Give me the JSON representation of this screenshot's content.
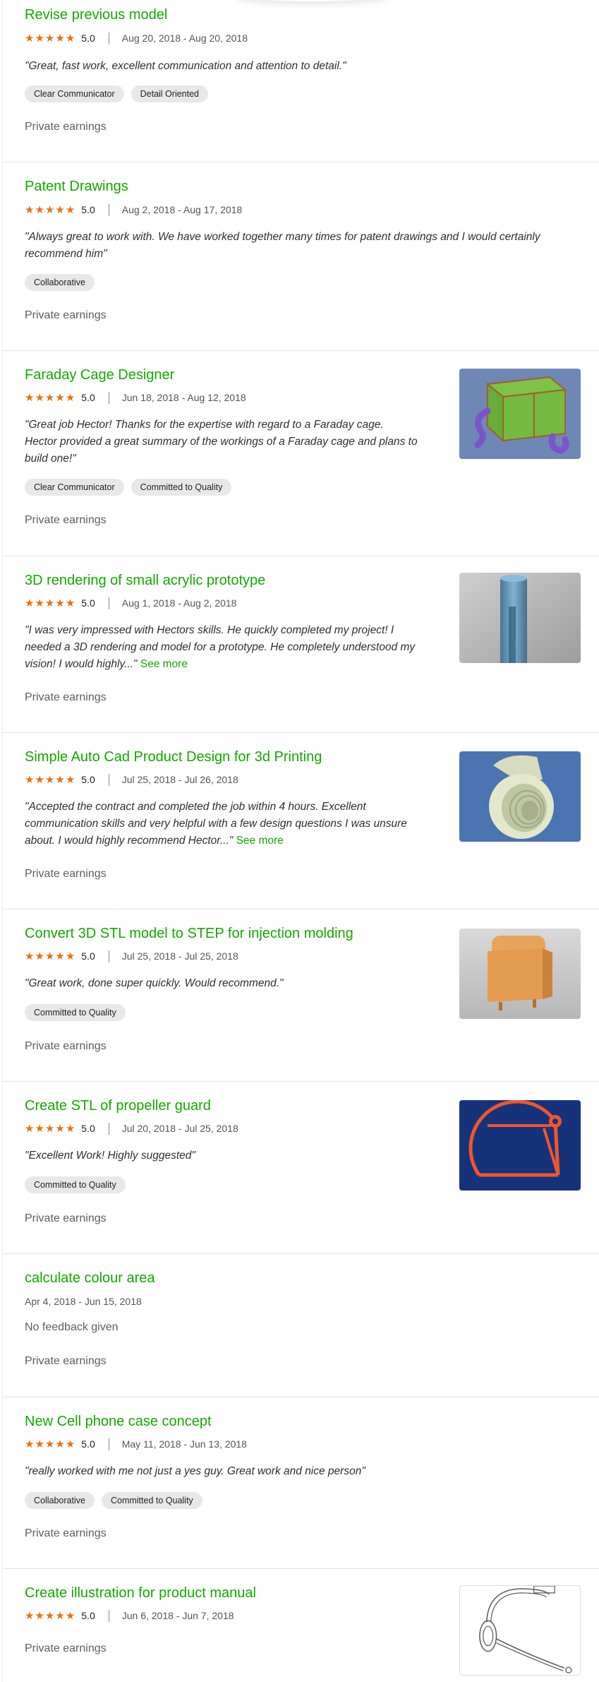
{
  "colors": {
    "accent_green": "#14a800",
    "star_orange": "#e8700f",
    "tag_bg": "#e8e8e8"
  },
  "star_icon": "★",
  "jobs": [
    {
      "title": "Revise previous model",
      "rating": 5,
      "score": "5.0",
      "dates": "Aug 20, 2018 - Aug 20, 2018",
      "quote": "\"Great, fast work, excellent communication and attention to detail.\"",
      "tags": [
        "Clear Communicator",
        "Detail Oriented"
      ],
      "earnings": "Private earnings"
    },
    {
      "title": "Patent Drawings",
      "rating": 5,
      "score": "5.0",
      "dates": "Aug 2, 2018 - Aug 17, 2018",
      "quote_lines": [
        "\"Always great to work with. We have worked together many times for patent drawings and I would certainly",
        "recommend him\""
      ],
      "tags": [
        "Collaborative"
      ],
      "earnings": "Private earnings"
    },
    {
      "title": "Faraday Cage Designer",
      "rating": 5,
      "score": "5.0",
      "dates": "Jun 18, 2018 - Aug 12, 2018",
      "quote_lines": [
        "\"Great job Hector! Thanks for the expertise with regard to a Faraday cage.",
        "Hector provided a great summary of the workings of a Faraday cage and plans to",
        "build one!\""
      ],
      "tags": [
        "Clear Communicator",
        "Committed to Quality"
      ],
      "earnings": "Private earnings",
      "thumbnail": "faraday-cage-render"
    },
    {
      "title": "3D rendering of small acrylic prototype",
      "rating": 5,
      "score": "5.0",
      "dates": "Aug 1, 2018 - Aug 2, 2018",
      "quote_lines": [
        "\"I was very impressed with Hectors skills. He quickly completed my project! I",
        "needed a 3D rendering and model for a prototype. He completely understood my",
        "vision! I would highly...\""
      ],
      "see_more": "See more",
      "earnings": "Private earnings",
      "thumbnail": "acrylic-cylinder-render"
    },
    {
      "title": "Simple Auto Cad Product Design for 3d Printing",
      "rating": 5,
      "score": "5.0",
      "dates": "Jul 25, 2018 - Jul 26, 2018",
      "quote_lines": [
        "\"Accepted the contract and completed the job within 4 hours. Excellent",
        "communication skills and very helpful with a few design questions I was unsure",
        "about. I would highly recommend Hector...\""
      ],
      "see_more": "See more",
      "earnings": "Private earnings",
      "thumbnail": "threaded-tube-render"
    },
    {
      "title": "Convert 3D STL model to STEP for injection molding",
      "rating": 5,
      "score": "5.0",
      "dates": "Jul 25, 2018 - Jul 25, 2018",
      "quote": "\"Great work, done super quickly. Would recommend.\"",
      "tags": [
        "Committed to Quality"
      ],
      "earnings": "Private earnings",
      "thumbnail": "orange-box-render"
    },
    {
      "title": "Create STL of propeller guard",
      "rating": 5,
      "score": "5.0",
      "dates": "Jul 20, 2018 - Jul 25, 2018",
      "quote": "\"Excellent Work! Highly suggested\"",
      "tags": [
        "Committed to Quality"
      ],
      "earnings": "Private earnings",
      "thumbnail": "propeller-guard-render"
    },
    {
      "title": "calculate colour area",
      "dates": "Apr 4, 2018 - Jun 15, 2018",
      "feedback": "No feedback given",
      "earnings": "Private earnings"
    },
    {
      "title": "New Cell phone case concept",
      "rating": 5,
      "score": "5.0",
      "dates": "May 11, 2018 - Jun 13, 2018",
      "quote": "\"really worked with me not just a yes guy. Great work and nice person\"",
      "tags": [
        "Collaborative",
        "Committed to Quality"
      ],
      "earnings": "Private earnings"
    },
    {
      "title": "Create illustration for product manual",
      "rating": 5,
      "score": "5.0",
      "dates": "Jun 6, 2018 - Jun 7, 2018",
      "earnings": "Private earnings",
      "thumbnail": "headset-line-drawing"
    }
  ]
}
